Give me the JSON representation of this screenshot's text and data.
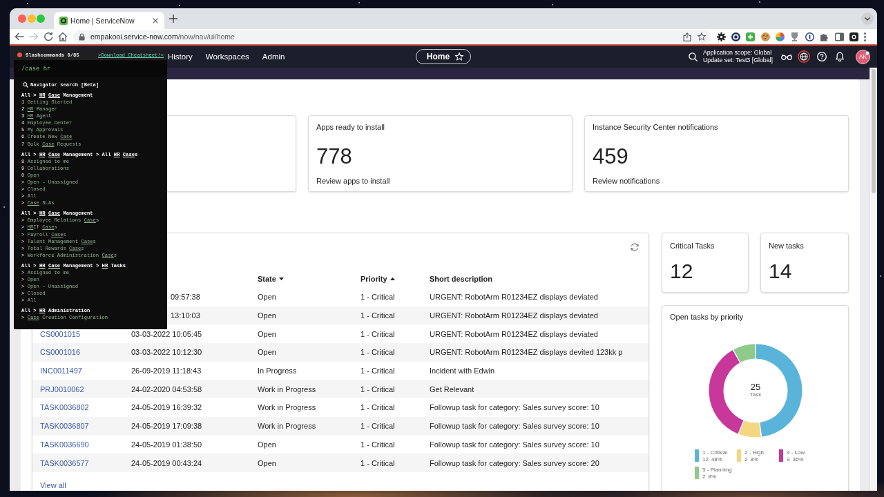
{
  "browser": {
    "tabs": [
      {
        "title": "Home | ServiceNow",
        "selected": true
      }
    ],
    "address": {
      "host": "empakooi.service-now.com",
      "path": "/now/nav/ui/home"
    }
  },
  "nav": {
    "items": [
      {
        "label": "History"
      },
      {
        "label": "Workspaces"
      },
      {
        "label": "Admin"
      }
    ],
    "page_title": "Home",
    "scope": "Application scope: Global",
    "update_set": "Update set: Test3 [Global]",
    "avatar": "AK"
  },
  "summary_cards": [
    {
      "title": "Apps ready to install",
      "value": "778",
      "link": "Review apps to install"
    },
    {
      "title": "Instance Security Center notifications",
      "value": "459",
      "link": "Review notifications"
    }
  ],
  "table": {
    "columns": [
      {
        "label": "State",
        "sorted": true,
        "descending": true
      },
      {
        "label": "Priority",
        "sorted": true,
        "descending": false
      },
      {
        "label": "Short description",
        "sorted": false
      }
    ],
    "rows": [
      {
        "column_2": "09:57:38",
        "state": "Open",
        "priority": "1 - Critical",
        "short_description": "URGENT: RobotArm R01234EZ displays deviated"
      },
      {
        "column_2": "13:10:03",
        "state": "Open",
        "priority": "1 - Critical",
        "short_description": "URGENT: RobotArm R01234EZ displays deviated"
      },
      {
        "column_1": "CS0001015",
        "column_2": "03-03-2022 10:05:45",
        "state": "Open",
        "priority": "1 - Critical",
        "short_description": "URGENT: RobotArm R01234EZ displays deviated"
      },
      {
        "column_1": "CS0001016",
        "column_2": "03-03-2022 10:12:30",
        "state": "Open",
        "priority": "1 - Critical",
        "short_description": "URGENT: RobotArm R01234EZ displays devited 123kk p"
      },
      {
        "column_1": "INC0011497",
        "column_2": "26-09-2019 11:18:43",
        "state": "In Progress",
        "priority": "1 - Critical",
        "short_description": "Incident with Edwin"
      },
      {
        "column_1": "PRJ0010062",
        "column_2": "24-02-2020 04:53:58",
        "state": "Work in Progress",
        "priority": "1 - Critical",
        "short_description": "Get Relevant"
      },
      {
        "column_1": "TASK0036802",
        "column_2": "24-05-2019 16:39:32",
        "state": "Work in Progress",
        "priority": "1 - Critical",
        "short_description": "Followup task for category: Sales survey score: 10"
      },
      {
        "column_1": "TASK0036807",
        "column_2": "24-05-2019 17:09:38",
        "state": "Work in Progress",
        "priority": "1 - Critical",
        "short_description": "Followup task for category: Sales survey score: 10"
      },
      {
        "column_1": "TASK0036690",
        "column_2": "24-05-2019 01:38:50",
        "state": "Open",
        "priority": "1 - Critical",
        "short_description": "Followup task for category: Sales survey score: 10"
      },
      {
        "column_1": "TASK0036577",
        "column_2": "24-05-2019 00:43:24",
        "state": "Open",
        "priority": "1 - Critical",
        "short_description": "Followup task for category: Sales survey score: 20"
      }
    ],
    "footer_link": "View all"
  },
  "stat_cards": [
    {
      "title": "Critical Tasks",
      "value": "12"
    },
    {
      "title": "New tasks",
      "value": "14"
    }
  ],
  "open_tasks": {
    "chart_data": {
      "type": "donut",
      "title": "Open tasks by priority",
      "categories": [
        "1 - Critical",
        "2 - High",
        "4 - Low",
        "5 - Planning"
      ],
      "values": [
        12,
        2,
        9,
        2
      ]
    },
    "center_value": "25",
    "center_label": "Task",
    "legend": [
      {
        "color": "#5ab4da",
        "count": "12",
        "percent": "48%"
      },
      {
        "color": "#f5d680",
        "count": "2",
        "percent": "8%"
      },
      {
        "color": "#c8379a",
        "count": "9",
        "percent": "36%"
      },
      {
        "color": "#8fca8a",
        "count": "2",
        "percent": "8%"
      }
    ]
  },
  "slash_commands": {
    "title": "Slashcommands 0/85",
    "link": ">Download Cheatsheet!<",
    "query": "/case hr",
    "search_label": "Navigator search [Beta]",
    "groups": [
      {
        "heading": [
          [
            {
              "text": "All >",
              "underlined": false
            }
          ],
          [
            {
              "text": "HR",
              "underlined": true
            }
          ],
          [
            {
              "text": "Case",
              "underlined": true
            }
          ],
          [
            {
              "text": "Management",
              "underlined": false
            }
          ]
        ],
        "items": [
          {
            "key": "1",
            "label": [
              [
                {
                  "text": "Getting Started",
                  "underlined": false
                }
              ]
            ]
          },
          {
            "key": "2",
            "label": [
              [
                {
                  "text": "HR",
                  "underlined": true
                }
              ],
              [
                {
                  "text": "Manager",
                  "underlined": false
                }
              ]
            ]
          },
          {
            "key": "3",
            "label": [
              [
                {
                  "text": "HR",
                  "underlined": true
                }
              ],
              [
                {
                  "text": "Agent",
                  "underlined": false
                }
              ]
            ]
          },
          {
            "key": "4",
            "label": [
              [
                {
                  "text": "Employee Center",
                  "underlined": false
                }
              ]
            ]
          },
          {
            "key": "5",
            "label": [
              [
                {
                  "text": "My Approvals",
                  "underlined": false
                }
              ]
            ]
          },
          {
            "key": "6",
            "label": [
              [
                {
                  "text": "Create New",
                  "underlined": false
                }
              ],
              [
                {
                  "text": "Case",
                  "underlined": true
                }
              ]
            ]
          },
          {
            "key": "7",
            "label": [
              [
                {
                  "text": "Bulk",
                  "underlined": false
                }
              ],
              [
                {
                  "text": "Case",
                  "underlined": true
                }
              ],
              [
                {
                  "text": "Requests",
                  "underlined": false
                }
              ]
            ]
          }
        ]
      },
      {
        "heading": [
          [
            {
              "text": "All >",
              "underlined": false
            }
          ],
          [
            {
              "text": "HR",
              "underlined": true
            }
          ],
          [
            {
              "text": "Case",
              "underlined": true
            }
          ],
          [
            {
              "text": "Management > All",
              "underlined": false
            }
          ],
          [
            {
              "text": "HR",
              "underlined": true
            }
          ],
          [
            {
              "text": "Case",
              "underlined": true
            },
            {
              "text": "s",
              "underlined": false
            }
          ]
        ],
        "items": [
          {
            "key": "8",
            "label": [
              [
                {
                  "text": "Assigned to me",
                  "underlined": false
                }
              ]
            ]
          },
          {
            "key": "9",
            "label": [
              [
                {
                  "text": "Collaborations",
                  "underlined": false
                }
              ]
            ]
          },
          {
            "key": "0",
            "label": [
              [
                {
                  "text": "Open",
                  "underlined": false
                }
              ]
            ]
          },
          {
            "key": ">",
            "label": [
              [
                {
                  "text": "Open – Unassigned",
                  "underlined": false
                }
              ]
            ]
          },
          {
            "key": ">",
            "label": [
              [
                {
                  "text": "Closed",
                  "underlined": false
                }
              ]
            ]
          },
          {
            "key": ">",
            "label": [
              [
                {
                  "text": "All",
                  "underlined": false
                }
              ]
            ]
          },
          {
            "key": ">",
            "label": [
              [
                {
                  "text": "Case",
                  "underlined": true
                }
              ],
              [
                {
                  "text": "SLAs",
                  "underlined": false
                }
              ]
            ]
          }
        ]
      },
      {
        "heading": [
          [
            {
              "text": "All >",
              "underlined": false
            }
          ],
          [
            {
              "text": "HR",
              "underlined": true
            }
          ],
          [
            {
              "text": "Case",
              "underlined": true
            }
          ],
          [
            {
              "text": "Management",
              "underlined": false
            }
          ]
        ],
        "items": [
          {
            "key": ">",
            "label": [
              [
                {
                  "text": "Employee Relations",
                  "underlined": false
                }
              ],
              [
                {
                  "text": "Case",
                  "underlined": true
                },
                {
                  "text": "s",
                  "underlined": false
                }
              ]
            ]
          },
          {
            "key": ">",
            "label": [
              [
                {
                  "text": "HR",
                  "underlined": true
                },
                {
                  "text": "IT",
                  "underlined": false
                }
              ],
              [
                {
                  "text": "Case",
                  "underlined": true
                },
                {
                  "text": "s",
                  "underlined": false
                }
              ]
            ]
          },
          {
            "key": ">",
            "label": [
              [
                {
                  "text": "Payroll",
                  "underlined": false
                }
              ],
              [
                {
                  "text": "Case",
                  "underlined": true
                },
                {
                  "text": "s",
                  "underlined": false
                }
              ]
            ]
          },
          {
            "key": ">",
            "label": [
              [
                {
                  "text": "Talent Management",
                  "underlined": false
                }
              ],
              [
                {
                  "text": "Case",
                  "underlined": true
                },
                {
                  "text": "s",
                  "underlined": false
                }
              ]
            ]
          },
          {
            "key": ">",
            "label": [
              [
                {
                  "text": "Total Rewards",
                  "underlined": false
                }
              ],
              [
                {
                  "text": "Case",
                  "underlined": true
                },
                {
                  "text": "s",
                  "underlined": false
                }
              ]
            ]
          },
          {
            "key": ">",
            "label": [
              [
                {
                  "text": "Workforce Administration",
                  "underlined": false
                }
              ],
              [
                {
                  "text": "Case",
                  "underlined": true
                },
                {
                  "text": "s",
                  "underlined": false
                }
              ]
            ]
          }
        ]
      },
      {
        "heading": [
          [
            {
              "text": "All >",
              "underlined": false
            }
          ],
          [
            {
              "text": "HR",
              "underlined": true
            }
          ],
          [
            {
              "text": "Case",
              "underlined": true
            }
          ],
          [
            {
              "text": "Management >",
              "underlined": false
            }
          ],
          [
            {
              "text": "HR",
              "underlined": true
            }
          ],
          [
            {
              "text": "Tasks",
              "underlined": false
            }
          ]
        ],
        "items": [
          {
            "key": ">",
            "label": [
              [
                {
                  "text": "Assigned to me",
                  "underlined": false
                }
              ]
            ]
          },
          {
            "key": ">",
            "label": [
              [
                {
                  "text": "Open",
                  "underlined": false
                }
              ]
            ]
          },
          {
            "key": ">",
            "label": [
              [
                {
                  "text": "Open – Unassigned",
                  "underlined": false
                }
              ]
            ]
          },
          {
            "key": ">",
            "label": [
              [
                {
                  "text": "Closed",
                  "underlined": false
                }
              ]
            ]
          },
          {
            "key": ">",
            "label": [
              [
                {
                  "text": "All",
                  "underlined": false
                }
              ]
            ]
          }
        ]
      },
      {
        "heading": [
          [
            {
              "text": "All >",
              "underlined": false
            }
          ],
          [
            {
              "text": "HR",
              "underlined": true
            }
          ],
          [
            {
              "text": "Administration",
              "underlined": false
            }
          ]
        ],
        "items": [
          {
            "key": ">",
            "label": [
              [
                {
                  "text": "Case",
                  "underlined": true
                }
              ],
              [
                {
                  "text": "Creation Configuration",
                  "underlined": false
                }
              ]
            ]
          }
        ]
      }
    ]
  }
}
